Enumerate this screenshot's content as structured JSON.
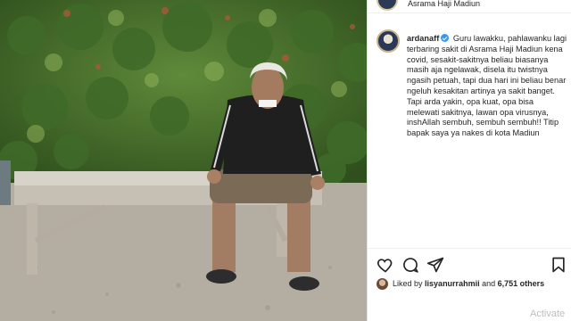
{
  "post": {
    "location": "Asrama Haji Madiun",
    "username": "ardanaff",
    "caption": "Guru lawakku, pahlawanku lagi terbaring sakit di Asrama Haji Madiun kena covid, sesakit-sakitnya beliau biasanya masih aja ngelawak, disela itu twistnya ngasih petuah, tapi dua hari ini beliau benar ngeluh kesakitan artinya ya sakit banget. Tapi arda yakin, opa kuat, opa bisa melewati sakitnya, lawan opa virusnya, inshAllah sembuh, sembuh sembuh!! Titip bapak saya ya nakes di kota Madiun"
  },
  "likes": {
    "prefix": "Liked by",
    "user": "lisyanurrahmii",
    "joiner": "and",
    "others": "6,751 others"
  },
  "icons": [
    "heart-icon",
    "comment-icon",
    "share-icon",
    "bookmark-icon",
    "verified-badge-icon"
  ],
  "colors": {
    "verified": "#3897f0",
    "text": "#262626"
  },
  "watermark": "Activate"
}
